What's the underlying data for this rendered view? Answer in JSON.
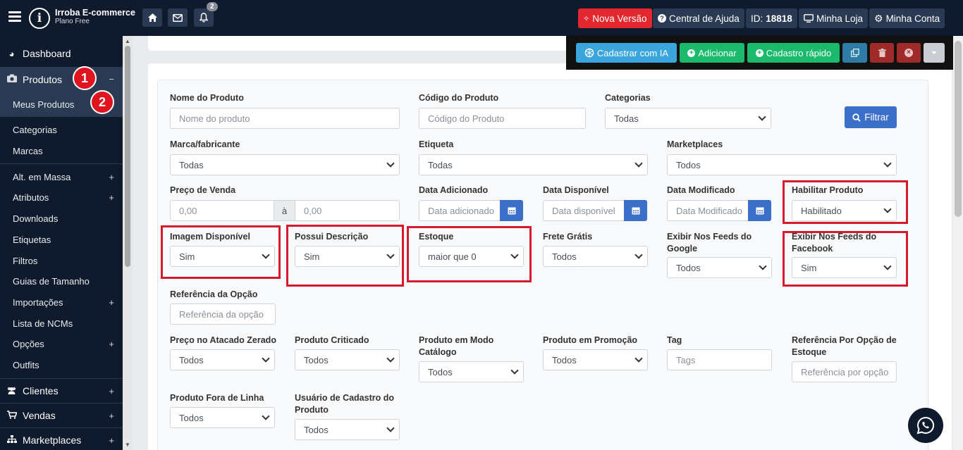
{
  "header": {
    "brand_name": "Irroba E-commerce",
    "brand_plan": "Plano Free",
    "logo_glyph": "i",
    "notification_count": "2",
    "nova_versao": "Nova Versão",
    "central_ajuda": "Central de Ajuda",
    "id_label": "ID:",
    "id_value": "18818",
    "minha_loja": "Minha Loja",
    "minha_conta": "Minha Conta"
  },
  "sidebar": {
    "dashboard": "Dashboard",
    "produtos": "Produtos",
    "meus_produtos": "Meus Produtos",
    "categorias": "Categorias",
    "marcas": "Marcas",
    "alt_massa": "Alt. em Massa",
    "atributos": "Atributos",
    "downloads": "Downloads",
    "etiquetas": "Etiquetas",
    "filtros": "Filtros",
    "guias_tamanho": "Guias de Tamanho",
    "importacoes": "Importações",
    "lista_ncms": "Lista de NCMs",
    "opcoes": "Opções",
    "outfits": "Outfits",
    "clientes": "Clientes",
    "vendas": "Vendas",
    "marketplaces": "Marketplaces"
  },
  "steps": {
    "one": "1",
    "two": "2"
  },
  "actions": {
    "cadastrar_ia": "Cadastrar com IA",
    "adicionar": "Adicionar",
    "cadastro_rapido": "Cadastro rápido"
  },
  "filters": {
    "nome_label": "Nome do Produto",
    "nome_ph": "Nome do produto",
    "codigo_label": "Código do Produto",
    "codigo_ph": "Código do Produto",
    "categorias_label": "Categorias",
    "categorias_val": "Todas",
    "filtrar": "Filtrar",
    "marca_label": "Marca/fabricante",
    "marca_val": "Todas",
    "etiqueta_label": "Etiqueta",
    "etiqueta_val": "Todas",
    "marketplaces_label": "Marketplaces",
    "marketplaces_val": "Todos",
    "preco_label": "Preço de Venda",
    "preco_de": "0,00",
    "preco_a": "à",
    "preco_ate": "0,00",
    "data_add_label": "Data Adicionado",
    "data_add_ph": "Data adicionado",
    "data_disp_label": "Data Disponível",
    "data_disp_ph": "Data disponível",
    "data_mod_label": "Data Modificado",
    "data_mod_ph": "Data Modificado",
    "habilitar_label": "Habilitar Produto",
    "habilitar_val": "Habilitado",
    "imagem_label": "Imagem Disponível",
    "imagem_val": "Sim",
    "descricao_label": "Possui Descrição",
    "descricao_val": "Sim",
    "estoque_label": "Estoque",
    "estoque_val": "maior que 0",
    "frete_label": "Frete Grátis",
    "frete_val": "Todos",
    "feeds_google_label": "Exibir Nos Feeds do Google",
    "feeds_google_val": "Todos",
    "feeds_fb_label": "Exibir Nos Feeds do Facebook",
    "feeds_fb_val": "Sim",
    "ref_opcao_label": "Referência da Opção",
    "ref_opcao_ph": "Referência da opção",
    "atacado_label": "Preço no Atacado Zerado",
    "atacado_val": "Todos",
    "criticado_label": "Produto Criticado",
    "criticado_val": "Todos",
    "catalogo_label": "Produto em Modo Catálogo",
    "catalogo_val": "Todos",
    "promocao_label": "Produto em Promoção",
    "promocao_val": "Todos",
    "tag_label": "Tag",
    "tag_ph": "Tags",
    "ref_estoque_label": "Referência Por Opção de Estoque",
    "ref_estoque_ph": "Referência por opção",
    "fora_linha_label": "Produto Fora de Linha",
    "fora_linha_val": "Todos",
    "usuario_label": "Usuário de Cadastro do Produto",
    "usuario_val": "Todos"
  },
  "colors": {
    "navbar": "#0f1b2d",
    "primary": "#3b6fc9",
    "highlight": "#d61a2e",
    "success": "#1ab96b",
    "info": "#3aa6dc"
  },
  "icons": [
    "hamburger-icon",
    "home-icon",
    "mail-icon",
    "bell-icon",
    "question-icon",
    "monitor-icon",
    "gear-icon",
    "dashboard-icon",
    "camera-icon",
    "users-icon",
    "cart-icon",
    "sitemap-icon",
    "openai-icon",
    "plus-circle-icon",
    "copy-icon",
    "trash-icon",
    "close-circle-icon",
    "caret-down-icon",
    "calendar-icon",
    "search-icon",
    "whatsapp-icon"
  ]
}
